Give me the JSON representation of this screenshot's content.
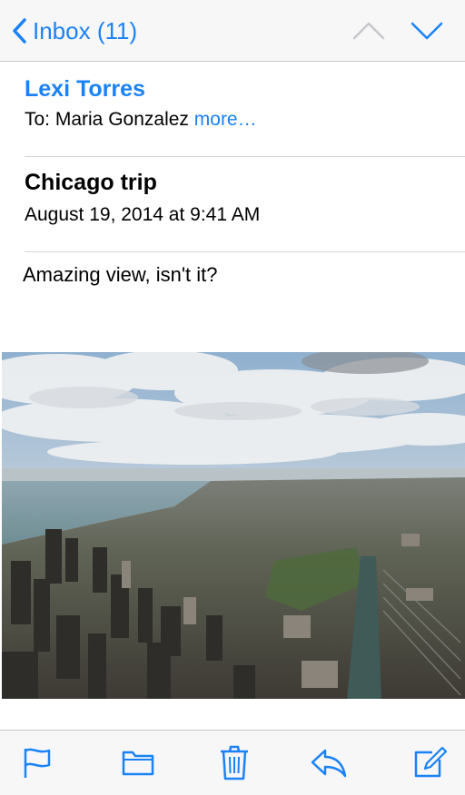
{
  "navbar": {
    "back_label": "Inbox (11)",
    "accent_color": "#1a82f7",
    "icons": {
      "back": "chevron-left-icon",
      "prev": "chevron-up-icon",
      "next": "chevron-down-icon"
    }
  },
  "message": {
    "sender": "Lexi Torres",
    "to_prefix": "To: Maria Gonzalez",
    "more_label": "more…",
    "subject": "Chicago trip",
    "date": "August 19, 2014 at 9:41 AM",
    "body": "Amazing view, isn't it?",
    "attachment": "photo of Chicago skyline from above"
  },
  "toolbar": {
    "icons": [
      "flag-icon",
      "folder-icon",
      "trash-icon",
      "reply-icon",
      "compose-icon"
    ]
  }
}
